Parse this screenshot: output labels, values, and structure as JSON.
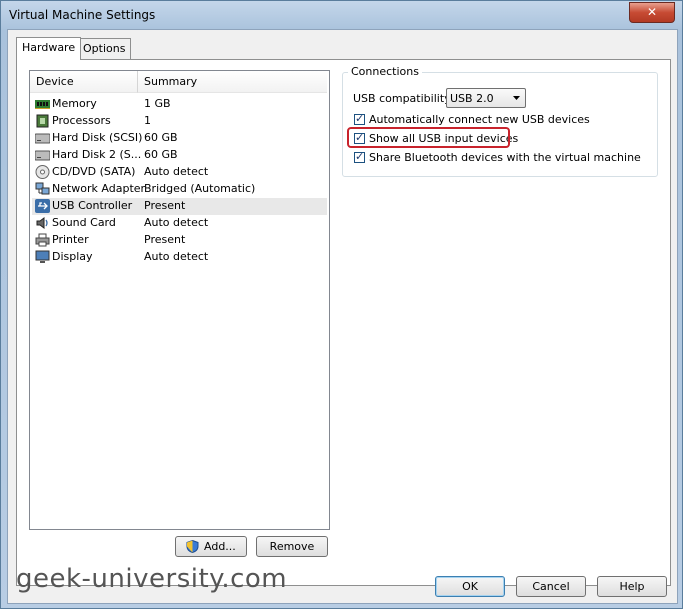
{
  "window": {
    "title": "Virtual Machine Settings",
    "close_glyph": "✕"
  },
  "tabs": [
    {
      "label": "Hardware",
      "active": true
    },
    {
      "label": "Options",
      "active": false
    }
  ],
  "device_list": {
    "columns": [
      "Device",
      "Summary"
    ],
    "rows": [
      {
        "device": "Memory",
        "summary": "1 GB",
        "icon": "memory-icon"
      },
      {
        "device": "Processors",
        "summary": "1",
        "icon": "processor-icon"
      },
      {
        "device": "Hard Disk (SCSI)",
        "summary": "60 GB",
        "icon": "hard-disk-icon"
      },
      {
        "device": "Hard Disk 2 (S...",
        "summary": "60 GB",
        "icon": "hard-disk-icon"
      },
      {
        "device": "CD/DVD (SATA)",
        "summary": "Auto detect",
        "icon": "cd-dvd-icon"
      },
      {
        "device": "Network Adapter",
        "summary": "Bridged (Automatic)",
        "icon": "network-adapter-icon"
      },
      {
        "device": "USB Controller",
        "summary": "Present",
        "icon": "usb-icon",
        "selected": true
      },
      {
        "device": "Sound Card",
        "summary": "Auto detect",
        "icon": "speaker-icon"
      },
      {
        "device": "Printer",
        "summary": "Present",
        "icon": "printer-icon"
      },
      {
        "device": "Display",
        "summary": "Auto detect",
        "icon": "display-icon"
      }
    ]
  },
  "buttons": {
    "add": "Add...",
    "remove": "Remove",
    "ok": "OK",
    "cancel": "Cancel",
    "help": "Help"
  },
  "connections": {
    "title": "Connections",
    "usb_compat_label": "USB compatibility:",
    "usb_compat_value": "USB 2.0",
    "checkboxes": [
      {
        "label": "Automatically connect new USB devices",
        "checked": true
      },
      {
        "label": "Show all USB input devices",
        "checked": true,
        "highlighted": true
      },
      {
        "label": "Share Bluetooth devices with the virtual machine",
        "checked": true
      }
    ]
  },
  "watermark": "geek-university.com",
  "colors": {
    "highlight": "#c8232c",
    "selection": "#e8e8e8"
  }
}
